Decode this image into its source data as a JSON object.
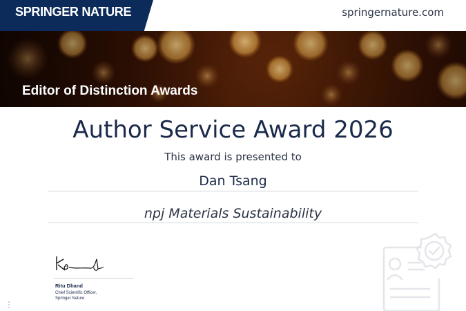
{
  "header": {
    "brand": "SPRINGER NATURE",
    "site_link": "springernature.com"
  },
  "banner": {
    "title": "Editor of Distinction Awards"
  },
  "certificate": {
    "award_title": "Author Service Award 2026",
    "presented_text": "This award is presented to",
    "recipient": "Dan Tsang",
    "journal": "npj Materials Sustainability"
  },
  "signatory": {
    "name": "Ritu Dhand",
    "role_line1": "Chief Scientific Officer,",
    "role_line2": "Springer Nature"
  },
  "colors": {
    "brand_navy": "#0c2b5b",
    "text_navy": "#1b2a4a",
    "banner_amber": "#e7a447"
  },
  "icons": [
    "certificate-badge-icon",
    "signature-graphic"
  ]
}
